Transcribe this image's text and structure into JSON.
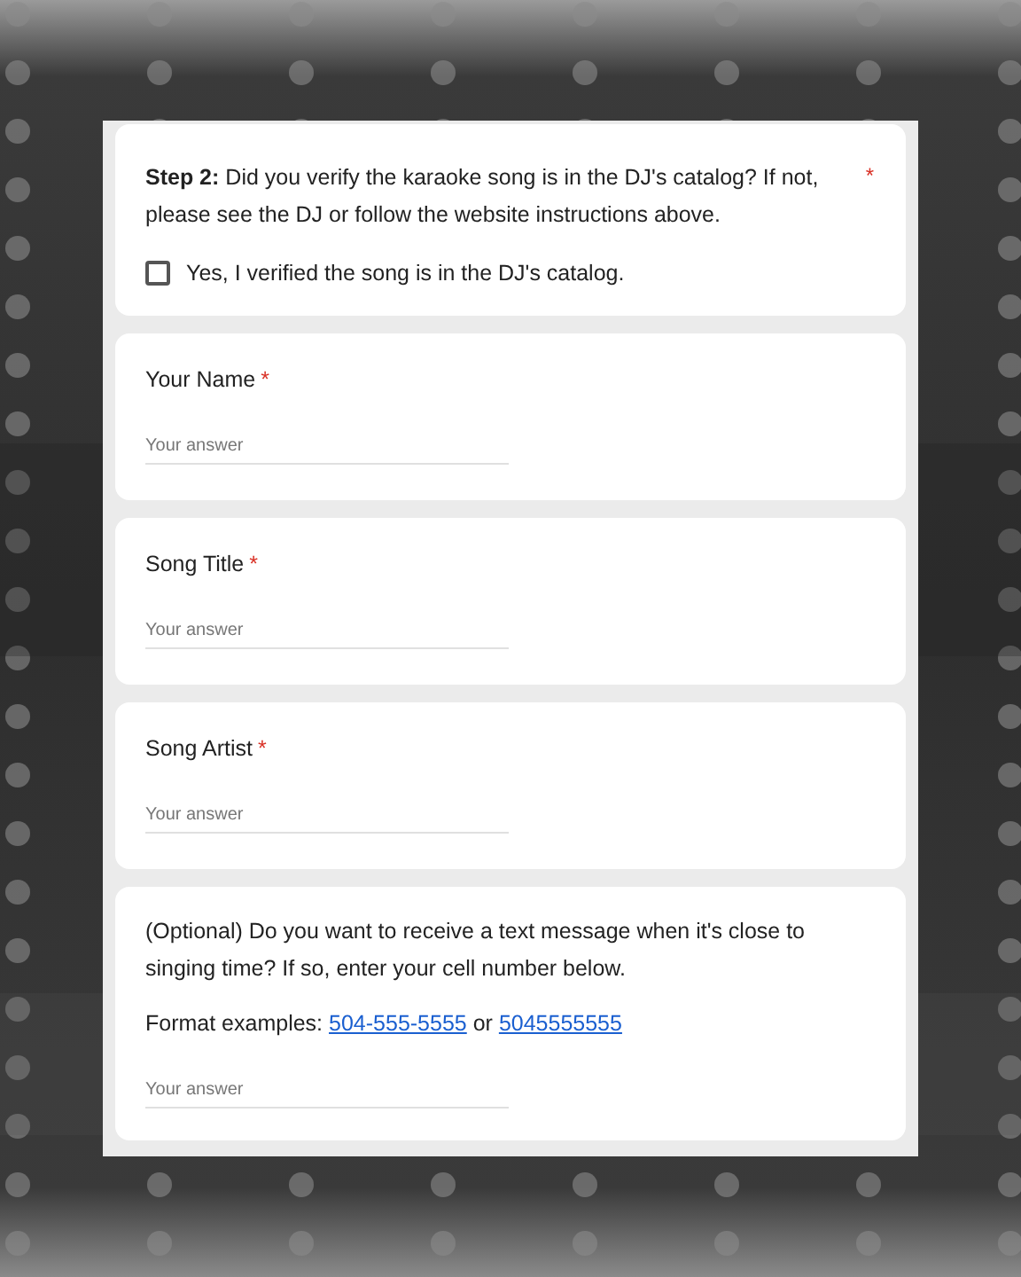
{
  "step_card": {
    "question": "**Step 2:** Did you verify the karaoke song is in the DJ's catalog? If not, please see the DJ or follow the website instructions above.",
    "asterisk": "*",
    "option": {
      "label": "Yes, I verified the song is in the DJ's catalog.",
      "checked": false
    }
  },
  "questions": [
    {
      "kind": "short",
      "label": "Your Name",
      "asterisk": "*",
      "placeholder": "Your answer"
    },
    {
      "kind": "short",
      "label": "Song Title",
      "asterisk": "*",
      "placeholder": "Your answer"
    },
    {
      "kind": "short",
      "label": "Song Artist",
      "asterisk": "*",
      "placeholder": "Your answer"
    },
    {
      "kind": "described",
      "description": "(Optional) Do you want to receive a text message when it's close to singing time? If so, enter your cell number below.",
      "format_label": "Format examples:",
      "links": [
        "504-555-5555",
        "5045555555"
      ],
      "separator": "or",
      "placeholder": "Your answer"
    }
  ]
}
